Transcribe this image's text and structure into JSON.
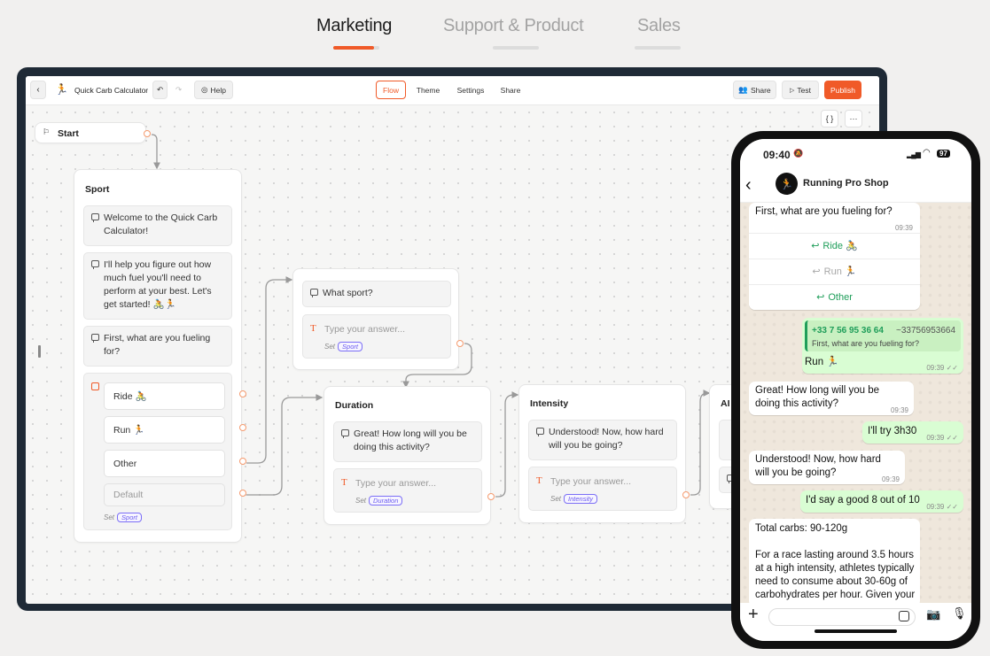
{
  "top_tabs": [
    {
      "label": "Marketing",
      "active": true
    },
    {
      "label": "Support & Product",
      "active": false
    },
    {
      "label": "Sales",
      "active": false
    }
  ],
  "colors": {
    "accent": "#f05a28",
    "variable_tag": "#6b5bf0",
    "whatsapp_green": "#1f9e5a",
    "outgoing_bubble": "#d9fdd3"
  },
  "toolbar": {
    "back_icon": "chevron-left-icon",
    "bot_name": "Quick Carb Calculator",
    "help_label": "Help",
    "tabs": [
      "Flow",
      "Theme",
      "Settings",
      "Share"
    ],
    "active_tab": "Flow",
    "share_label": "Share",
    "test_label": "Test",
    "publish_label": "Publish",
    "code_btn": "{ }",
    "more_btn": "···"
  },
  "flow": {
    "start": {
      "label": "Start"
    },
    "sport": {
      "title": "Sport",
      "messages": [
        "Welcome to the Quick Carb Calculator!",
        "I'll help you figure out how much fuel you'll need to perform at your best. Let's get started! 🚴🏃",
        "First, what are you fueling for?"
      ],
      "choices": [
        "Ride 🚴",
        "Run 🏃",
        "Other"
      ],
      "default_label": "Default",
      "set_label": "Set",
      "variable": "Sport"
    },
    "what_sport": {
      "message": "What sport?",
      "placeholder": "Type your answer...",
      "set_label": "Set",
      "variable": "Sport"
    },
    "duration": {
      "title": "Duration",
      "message": "Great! How long will you be doing this activity?",
      "placeholder": "Type your answer...",
      "set_label": "Set",
      "variable": "Duration"
    },
    "intensity": {
      "title": "Intensity",
      "message": "Understood! Now, how hard will you be going?",
      "placeholder": "Type your answer...",
      "set_label": "Set",
      "variable": "Intensity"
    },
    "ai": {
      "title": "AI"
    }
  },
  "phone": {
    "time": "09:40",
    "battery": "97",
    "contact": "Running Pro Shop",
    "messages": [
      {
        "dir": "in",
        "text": "First, what are you fueling for?",
        "time": "09:39",
        "replies": [
          "Ride 🚴",
          "Run 🏃",
          "Other"
        ]
      },
      {
        "dir": "out",
        "quote_name": "+33 7 56 95 36 64",
        "quote_alias": "~33756953664",
        "quote_text": "First, what are you fueling for?",
        "text": "Run 🏃",
        "time": "09:39"
      },
      {
        "dir": "in",
        "text": "Great! How long will you be doing this activity?",
        "time": "09:39"
      },
      {
        "dir": "out",
        "text": "I'll try 3h30",
        "time": "09:39"
      },
      {
        "dir": "in",
        "text": "Understood! Now, how hard will you be going?",
        "time": "09:39"
      },
      {
        "dir": "out",
        "text": "I'd say a good 8 out of 10",
        "time": "09:39"
      },
      {
        "dir": "in",
        "text_1": "Total carbs: 90-120g",
        "text_2": "For a race lasting around 3.5 hours at a high intensity, athletes typically need to consume about 30-60g of carbohydrates per hour. Given your"
      }
    ]
  }
}
